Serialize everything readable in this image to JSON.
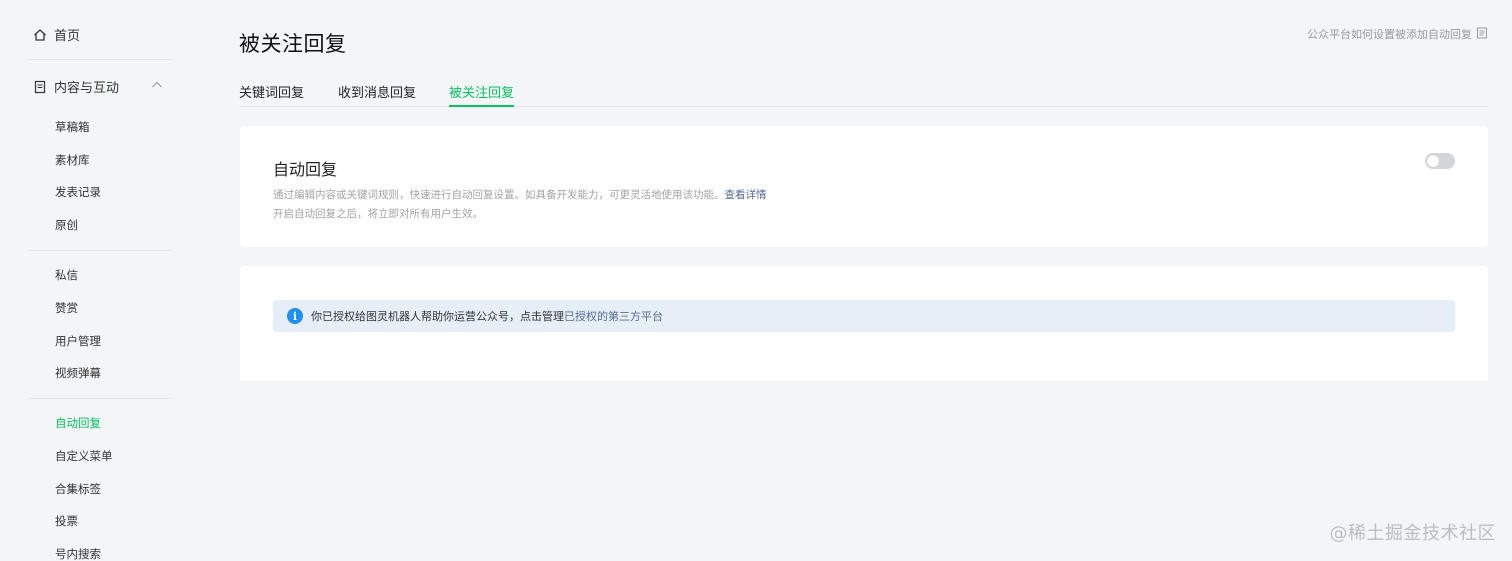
{
  "sidebar": {
    "home_label": "首页",
    "content_label": "内容与互动",
    "group1": [
      "草稿箱",
      "素材库",
      "发表记录",
      "原创"
    ],
    "group2": [
      "私信",
      "赞赏",
      "用户管理",
      "视频弹幕"
    ],
    "group3": [
      "自动回复",
      "自定义菜单",
      "合集标签",
      "投票",
      "号内搜索"
    ],
    "active_item": "自动回复"
  },
  "header": {
    "title": "被关注回复",
    "help_link": "公众平台如何设置被添加自动回复"
  },
  "tabs": [
    "关键词回复",
    "收到消息回复",
    "被关注回复"
  ],
  "active_tab": "被关注回复",
  "auto_reply": {
    "title": "自动回复",
    "desc_line1": "通过编辑内容或关键词规则，快速进行自动回复设置。如具备开发能力，可更灵活地使用该功能。",
    "desc_link": "查看详情",
    "desc_line2": "开启自动回复之后，将立即对所有用户生效。",
    "enabled": false
  },
  "notice": {
    "text": "你已授权给图灵机器人帮助你运营公众号，点击管理",
    "link": "已授权的第三方平台"
  },
  "watermark": "@稀土掘金技术社区",
  "colors": {
    "accent": "#07c160",
    "link": "#576b95",
    "info": "#1f8ff0",
    "notice_bg": "#e6eef8"
  }
}
